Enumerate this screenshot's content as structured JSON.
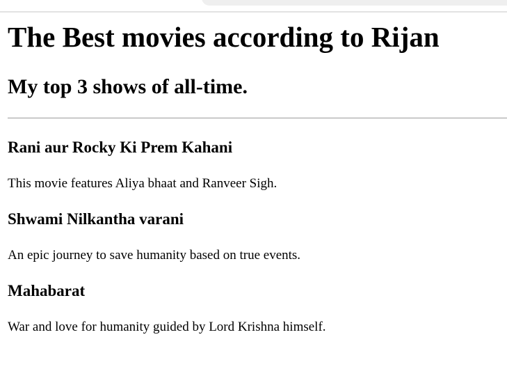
{
  "header": {
    "title": "The Best movies according to Rijan",
    "subtitle": "My top 3 shows of all-time."
  },
  "movies": [
    {
      "title": "Rani aur Rocky Ki Prem Kahani",
      "description": "This movie features Aliya bhaat and Ranveer Sigh."
    },
    {
      "title": "Shwami Nilkantha varani",
      "description": "An epic journey to save humanity based on true events."
    },
    {
      "title": "Mahabarat",
      "description": "War and love for humanity guided by Lord Krishna himself."
    }
  ]
}
